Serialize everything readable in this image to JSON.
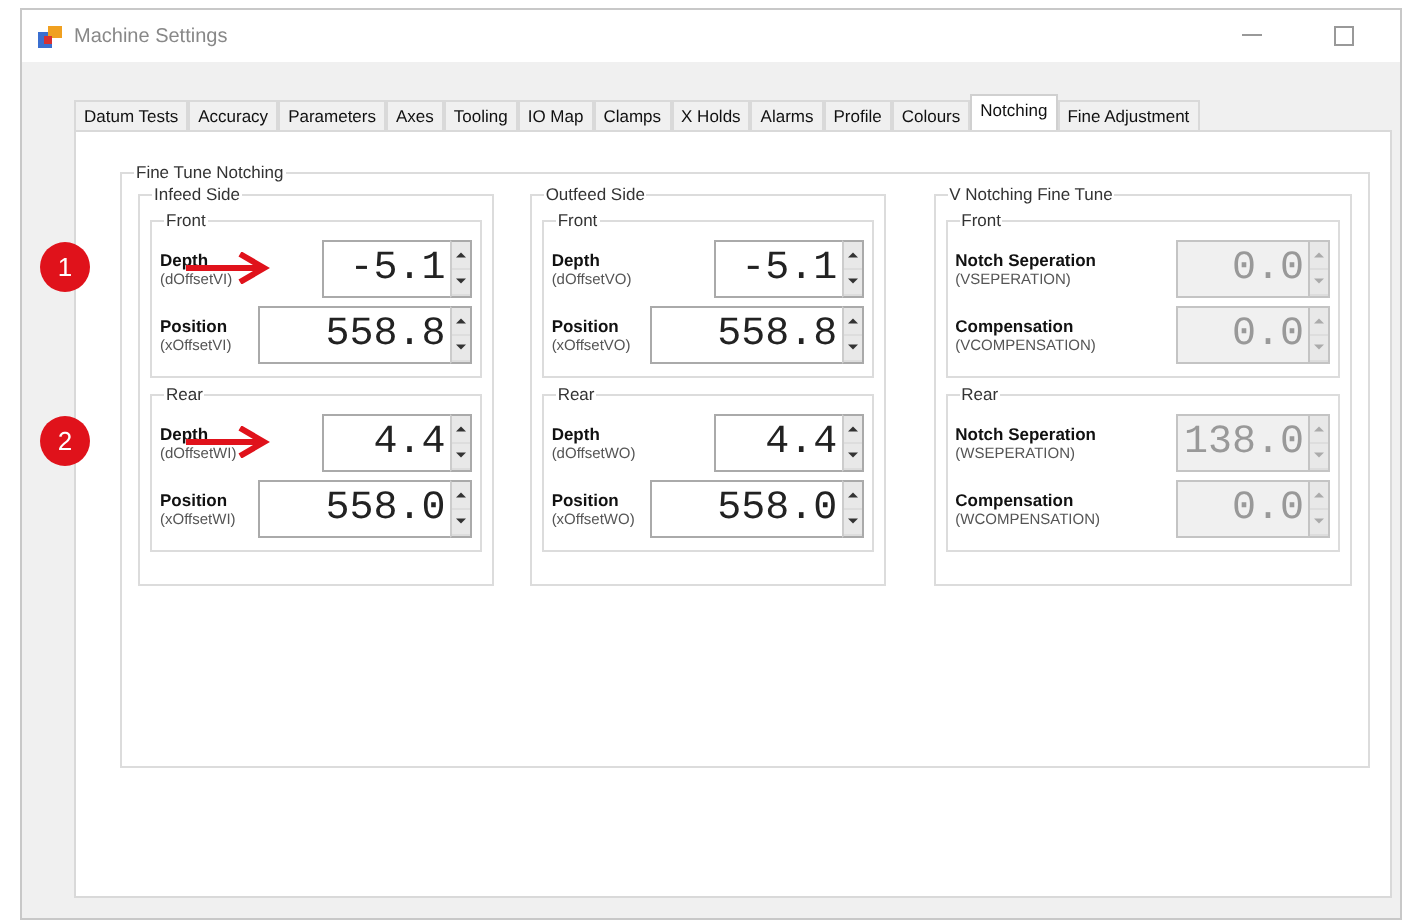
{
  "window": {
    "title": "Machine Settings"
  },
  "tabs": [
    {
      "label": "Datum Tests",
      "selected": false
    },
    {
      "label": "Accuracy",
      "selected": false
    },
    {
      "label": "Parameters",
      "selected": false
    },
    {
      "label": "Axes",
      "selected": false
    },
    {
      "label": "Tooling",
      "selected": false
    },
    {
      "label": "IO Map",
      "selected": false
    },
    {
      "label": "Clamps",
      "selected": false
    },
    {
      "label": "X Holds",
      "selected": false
    },
    {
      "label": "Alarms",
      "selected": false
    },
    {
      "label": "Profile",
      "selected": false
    },
    {
      "label": "Colours",
      "selected": false
    },
    {
      "label": "Notching",
      "selected": true
    },
    {
      "label": "Fine Adjustment",
      "selected": false
    }
  ],
  "group": {
    "title": "Fine Tune Notching",
    "sides": [
      {
        "title": "Infeed Side",
        "sections": [
          {
            "title": "Front",
            "fields": [
              {
                "label": "Depth",
                "sublabel": "(dOffsetVI)",
                "value": "-5.1",
                "disabled": false,
                "callout": "1"
              },
              {
                "label": "Position",
                "sublabel": "(xOffsetVI)",
                "value": "558.8",
                "disabled": false
              }
            ]
          },
          {
            "title": "Rear",
            "fields": [
              {
                "label": "Depth",
                "sublabel": "(dOffsetWI)",
                "value": "4.4",
                "disabled": false,
                "callout": "2"
              },
              {
                "label": "Position",
                "sublabel": "(xOffsetWI)",
                "value": "558.0",
                "disabled": false
              }
            ]
          }
        ]
      },
      {
        "title": "Outfeed Side",
        "sections": [
          {
            "title": "Front",
            "fields": [
              {
                "label": "Depth",
                "sublabel": "(dOffsetVO)",
                "value": "-5.1",
                "disabled": false
              },
              {
                "label": "Position",
                "sublabel": "(xOffsetVO)",
                "value": "558.8",
                "disabled": false
              }
            ]
          },
          {
            "title": "Rear",
            "fields": [
              {
                "label": "Depth",
                "sublabel": "(dOffsetWO)",
                "value": "4.4",
                "disabled": false
              },
              {
                "label": "Position",
                "sublabel": "(xOffsetWO)",
                "value": "558.0",
                "disabled": false
              }
            ]
          }
        ]
      },
      {
        "title": "V Notching Fine Tune",
        "sections": [
          {
            "title": "Front",
            "fields": [
              {
                "label": "Notch Seperation",
                "sublabel": "(VSEPERATION)",
                "value": "0.0",
                "disabled": true
              },
              {
                "label": "Compensation",
                "sublabel": "(VCOMPENSATION)",
                "value": "0.0",
                "disabled": true
              }
            ]
          },
          {
            "title": "Rear",
            "fields": [
              {
                "label": "Notch Seperation",
                "sublabel": "(WSEPERATION)",
                "value": "138.0",
                "disabled": true
              },
              {
                "label": "Compensation",
                "sublabel": "(WCOMPENSATION)",
                "value": "0.0",
                "disabled": true
              }
            ]
          }
        ]
      }
    ]
  }
}
